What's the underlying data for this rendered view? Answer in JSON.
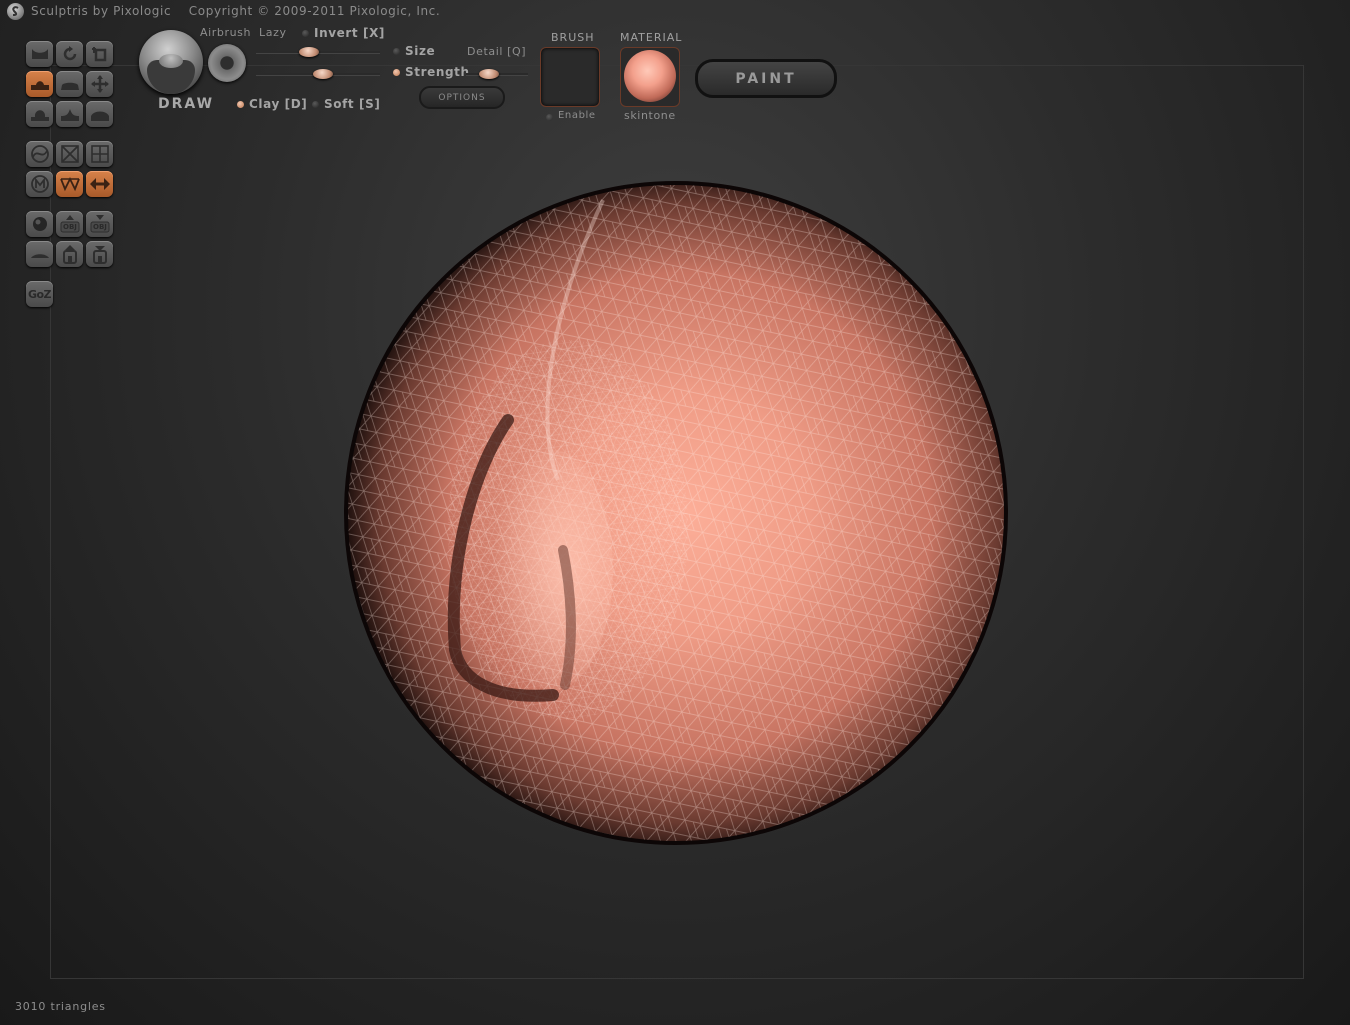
{
  "app": {
    "title": "Sculptris by Pixologic    Copyright © 2009-2011 Pixologic, Inc."
  },
  "toolbar": {
    "tools": [
      {
        "name": "crease-tool",
        "icon": "crease-icon",
        "active": false
      },
      {
        "name": "rotate-tool",
        "icon": "rotate-icon",
        "active": false
      },
      {
        "name": "scale-tool",
        "icon": "scale-icon",
        "active": false
      },
      {
        "name": "draw-tool",
        "icon": "draw-icon",
        "active": true
      },
      {
        "name": "flatten-tool",
        "icon": "flatten-icon",
        "active": false
      },
      {
        "name": "grab-tool",
        "icon": "grab-icon",
        "active": false
      },
      {
        "name": "inflate-tool",
        "icon": "inflate-icon",
        "active": false
      },
      {
        "name": "pinch-tool",
        "icon": "pinch-icon",
        "active": false
      },
      {
        "name": "smooth-tool",
        "icon": "smooth-icon",
        "active": false
      },
      {
        "name": "reduce-brush-tool",
        "icon": "reduce-brush-icon",
        "active": false
      },
      {
        "name": "reduce-selected-tool",
        "icon": "reduce-selected-icon",
        "active": false
      },
      {
        "name": "subdivide-all-tool",
        "icon": "subdivide-all-icon",
        "active": false
      },
      {
        "name": "mask-tool",
        "icon": "mask-icon",
        "active": false
      },
      {
        "name": "wireframe-toggle",
        "icon": "wireframe-icon",
        "active": true
      },
      {
        "name": "symmetry-toggle",
        "icon": "symmetry-icon",
        "active": true
      },
      {
        "name": "new-sphere-button",
        "icon": "sphere-icon",
        "active": false
      },
      {
        "name": "import-obj-button",
        "icon": "import-obj-icon",
        "active": false
      },
      {
        "name": "export-obj-button",
        "icon": "export-obj-icon",
        "active": false
      },
      {
        "name": "new-plane-button",
        "icon": "plane-icon",
        "active": false
      },
      {
        "name": "open-button",
        "icon": "open-icon",
        "active": false
      },
      {
        "name": "save-button",
        "icon": "save-icon",
        "active": false
      }
    ],
    "goz_label": "GoZ",
    "obj_label": "OBJ"
  },
  "brush": {
    "name": "DRAW",
    "airbrush_label": "Airbrush",
    "lazy_label": "Lazy",
    "invert_label": "Invert [X]",
    "size_label": "Size",
    "strength_label": "Strength",
    "detail_label": "Detail [Q]",
    "clay_label": "Clay [D]",
    "soft_label": "Soft [S]",
    "options_label": "OPTIONS",
    "size": 0.45,
    "strength": 0.52,
    "detail": 0.4,
    "clay_on": true,
    "soft_on": false,
    "invert_on": false
  },
  "brush_panel": {
    "heading": "BRUSH",
    "enable_label": "Enable"
  },
  "material_panel": {
    "heading": "MATERIAL",
    "material_name": "skintone",
    "color": "#f3a08c"
  },
  "mode_button": {
    "label": "PAINT"
  },
  "status": {
    "triangles": "3010 triangles"
  },
  "colors": {
    "accent_orange": "#c8723c",
    "skin": "#f3a08c"
  }
}
